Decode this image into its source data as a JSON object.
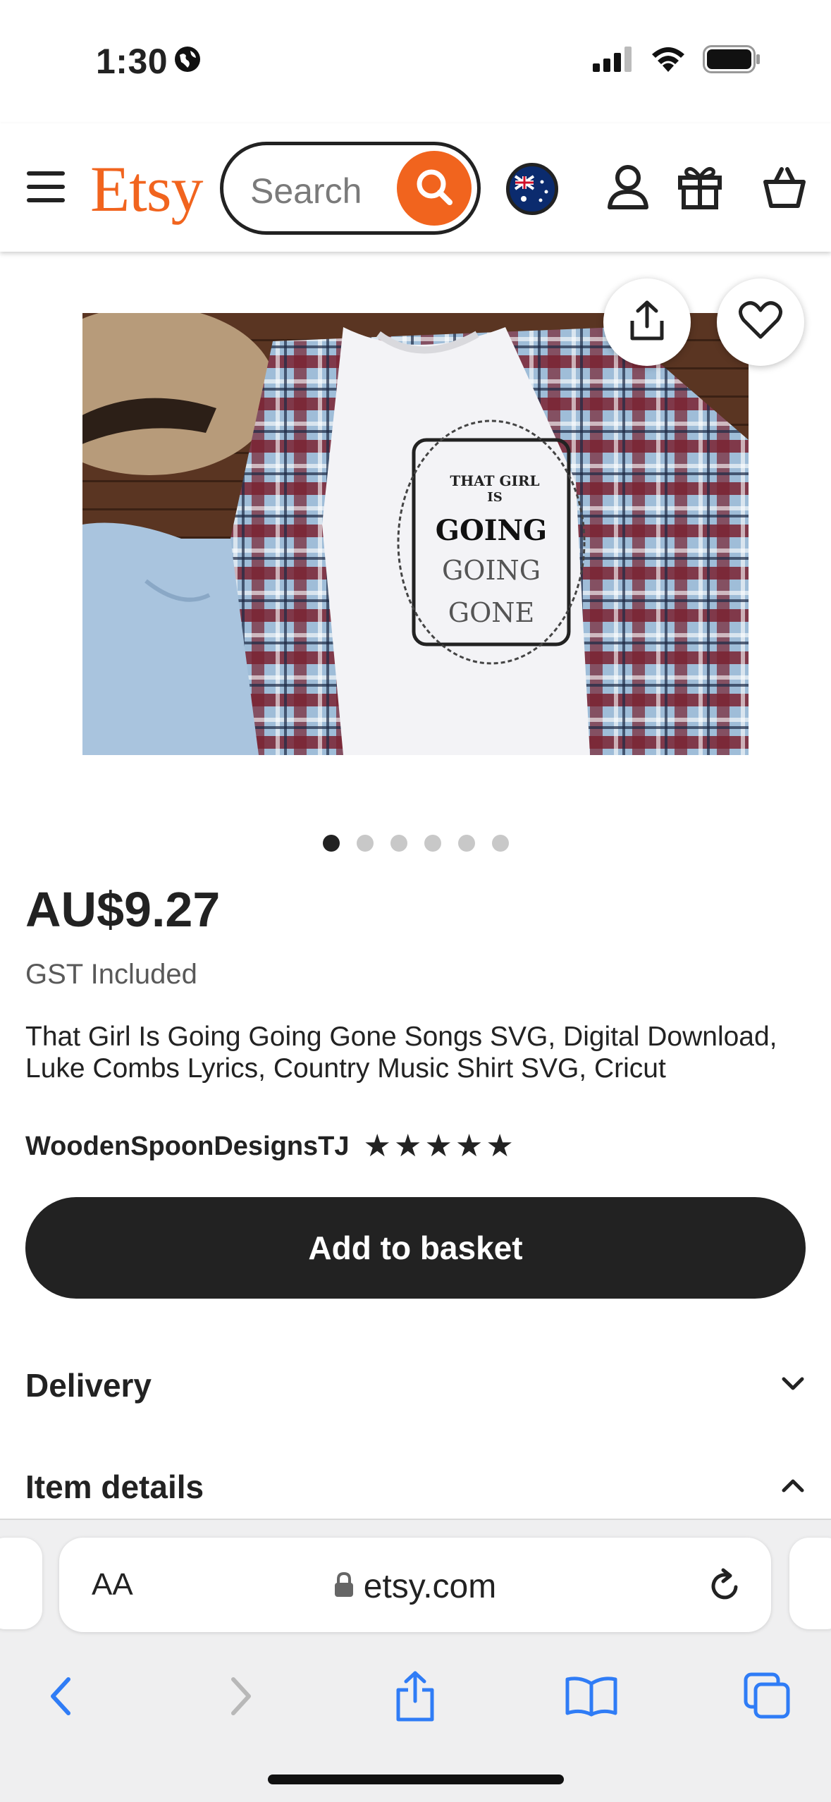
{
  "status_bar": {
    "time": "1:30",
    "icons": [
      "globe-icon",
      "cellular-signal-icon",
      "wifi-icon",
      "battery-icon"
    ]
  },
  "header": {
    "logo": "Etsy",
    "search_placeholder": "Search",
    "region_flag": "australia-flag-icon",
    "icons": [
      "menu-icon",
      "search-icon",
      "account-icon",
      "gift-icon",
      "basket-icon"
    ],
    "accent_color": "#f1641e"
  },
  "product": {
    "image": {
      "shirt_text": [
        "THAT GIRL",
        "IS",
        "GOING",
        "GOING",
        "GONE"
      ],
      "total_images": 6,
      "active_index": 0
    },
    "price": "AU$9.27",
    "tax_note": "GST Included",
    "title": "That Girl Is Going Going Gone Songs SVG, Digital Download, Luke Combs Lyrics, Country Music Shirt SVG, Cricut",
    "shop_name": "WoodenSpoonDesignsTJ",
    "rating_stars": 5,
    "add_to_basket_label": "Add to basket"
  },
  "sections": [
    {
      "label": "Delivery",
      "state": "collapsed"
    },
    {
      "label": "Item details",
      "state": "expanded"
    }
  ],
  "browser": {
    "text_size_label": "AA",
    "url": "etsy.com",
    "toolbar_icons": [
      "back-icon",
      "forward-icon",
      "share-icon",
      "bookmarks-icon",
      "tabs-icon"
    ],
    "link_color": "#2f7cf6"
  }
}
